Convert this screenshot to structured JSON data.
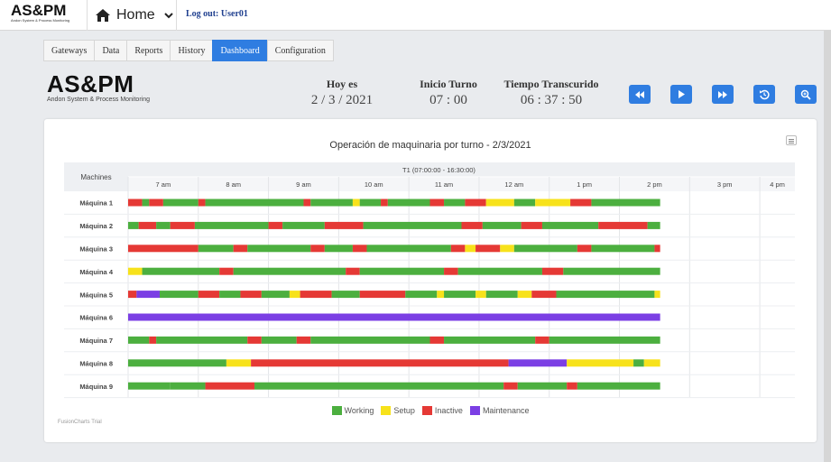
{
  "header": {
    "brand": "AS&PM",
    "brand_subtitle": "Andon System & Process Monitoring",
    "home_label": "Home",
    "logout_label": "Log out: User01"
  },
  "tabs": [
    {
      "label": "Gateways",
      "active": false
    },
    {
      "label": "Data",
      "active": false
    },
    {
      "label": "Reports",
      "active": false
    },
    {
      "label": "History",
      "active": false
    },
    {
      "label": "Dashboard",
      "active": true
    },
    {
      "label": "Configuration",
      "active": false
    }
  ],
  "logo": {
    "title": "AS&PM",
    "subtitle": "Andon System & Process Monitoring"
  },
  "stats": {
    "today_label": "Hoy es",
    "today_value": "2 / 3 / 2021",
    "shift_start_label": "Inicio Turno",
    "shift_start_value": "07 : 00",
    "elapsed_label": "Tiempo Transcurido",
    "elapsed_value": "06 : 37 : 50"
  },
  "controls": [
    "rewind-icon",
    "play-icon",
    "fast-forward-icon",
    "history-icon",
    "zoom-icon"
  ],
  "chart_footer": "FusionCharts Trial",
  "colors": {
    "Working": "#4caf3f",
    "Setup": "#f7e21b",
    "Inactive": "#e53935",
    "Maintenance": "#7b3fe4",
    "accent": "#2f7de1"
  },
  "chart_data": {
    "type": "gantt",
    "title": "Operación de maquinaria por turno - 2/3/2021",
    "row_header": "Machines",
    "shift_label": "T1 (07:00:00 - 16:30:00)",
    "hours": [
      "7 am",
      "8 am",
      "9 am",
      "10 am",
      "11 am",
      "12 am",
      "1 pm",
      "2 pm",
      "3 pm",
      "4 pm"
    ],
    "time_range": [
      7.0,
      16.5
    ],
    "legend": [
      "Working",
      "Setup",
      "Inactive",
      "Maintenance"
    ],
    "machines": [
      {
        "name": "Máquina 1",
        "segments": [
          [
            7.0,
            7.2,
            "Inactive"
          ],
          [
            7.2,
            7.3,
            "Working"
          ],
          [
            7.3,
            7.5,
            "Inactive"
          ],
          [
            7.5,
            8.0,
            "Working"
          ],
          [
            8.0,
            8.1,
            "Inactive"
          ],
          [
            8.1,
            9.5,
            "Working"
          ],
          [
            9.5,
            9.6,
            "Inactive"
          ],
          [
            9.6,
            10.2,
            "Working"
          ],
          [
            10.2,
            10.3,
            "Setup"
          ],
          [
            10.3,
            10.6,
            "Working"
          ],
          [
            10.6,
            10.7,
            "Inactive"
          ],
          [
            10.7,
            11.3,
            "Working"
          ],
          [
            11.3,
            11.5,
            "Inactive"
          ],
          [
            11.5,
            11.8,
            "Working"
          ],
          [
            11.8,
            12.1,
            "Inactive"
          ],
          [
            12.1,
            12.5,
            "Setup"
          ],
          [
            12.5,
            12.8,
            "Working"
          ],
          [
            12.8,
            13.3,
            "Setup"
          ],
          [
            13.3,
            13.6,
            "Inactive"
          ],
          [
            13.6,
            14.58,
            "Working"
          ]
        ]
      },
      {
        "name": "Máquina 2",
        "segments": [
          [
            7.0,
            7.15,
            "Working"
          ],
          [
            7.15,
            7.4,
            "Inactive"
          ],
          [
            7.4,
            7.6,
            "Working"
          ],
          [
            7.6,
            7.95,
            "Inactive"
          ],
          [
            7.95,
            9.0,
            "Working"
          ],
          [
            9.0,
            9.2,
            "Inactive"
          ],
          [
            9.2,
            9.8,
            "Working"
          ],
          [
            9.8,
            10.35,
            "Inactive"
          ],
          [
            10.35,
            11.75,
            "Working"
          ],
          [
            11.75,
            12.05,
            "Inactive"
          ],
          [
            12.05,
            12.6,
            "Working"
          ],
          [
            12.6,
            12.9,
            "Inactive"
          ],
          [
            12.9,
            13.7,
            "Working"
          ],
          [
            13.7,
            14.4,
            "Inactive"
          ],
          [
            14.4,
            14.58,
            "Working"
          ]
        ]
      },
      {
        "name": "Máquina 3",
        "segments": [
          [
            7.0,
            8.0,
            "Inactive"
          ],
          [
            8.0,
            8.5,
            "Working"
          ],
          [
            8.5,
            8.7,
            "Inactive"
          ],
          [
            8.7,
            9.6,
            "Working"
          ],
          [
            9.6,
            9.8,
            "Inactive"
          ],
          [
            9.8,
            10.2,
            "Working"
          ],
          [
            10.2,
            10.4,
            "Inactive"
          ],
          [
            10.4,
            11.6,
            "Working"
          ],
          [
            11.6,
            11.8,
            "Inactive"
          ],
          [
            11.8,
            11.95,
            "Setup"
          ],
          [
            11.95,
            12.3,
            "Inactive"
          ],
          [
            12.3,
            12.5,
            "Setup"
          ],
          [
            12.5,
            13.4,
            "Working"
          ],
          [
            13.4,
            13.6,
            "Inactive"
          ],
          [
            13.6,
            14.5,
            "Working"
          ],
          [
            14.5,
            14.58,
            "Inactive"
          ]
        ]
      },
      {
        "name": "Máquina 4",
        "segments": [
          [
            7.0,
            7.2,
            "Setup"
          ],
          [
            7.2,
            8.3,
            "Working"
          ],
          [
            8.3,
            8.5,
            "Inactive"
          ],
          [
            8.5,
            10.1,
            "Working"
          ],
          [
            10.1,
            10.3,
            "Inactive"
          ],
          [
            10.3,
            11.5,
            "Working"
          ],
          [
            11.5,
            11.7,
            "Inactive"
          ],
          [
            11.7,
            12.9,
            "Working"
          ],
          [
            12.9,
            13.2,
            "Inactive"
          ],
          [
            13.2,
            14.58,
            "Working"
          ]
        ]
      },
      {
        "name": "Máquina 5",
        "segments": [
          [
            7.0,
            7.12,
            "Inactive"
          ],
          [
            7.12,
            7.45,
            "Maintenance"
          ],
          [
            7.45,
            8.0,
            "Working"
          ],
          [
            8.0,
            8.3,
            "Inactive"
          ],
          [
            8.3,
            8.6,
            "Working"
          ],
          [
            8.6,
            8.9,
            "Inactive"
          ],
          [
            8.9,
            9.3,
            "Working"
          ],
          [
            9.3,
            9.45,
            "Setup"
          ],
          [
            9.45,
            9.9,
            "Inactive"
          ],
          [
            9.9,
            10.3,
            "Working"
          ],
          [
            10.3,
            10.95,
            "Inactive"
          ],
          [
            10.95,
            11.4,
            "Working"
          ],
          [
            11.4,
            11.5,
            "Setup"
          ],
          [
            11.5,
            11.95,
            "Working"
          ],
          [
            11.95,
            12.1,
            "Setup"
          ],
          [
            12.1,
            12.55,
            "Working"
          ],
          [
            12.55,
            12.75,
            "Setup"
          ],
          [
            12.75,
            13.1,
            "Inactive"
          ],
          [
            13.1,
            14.5,
            "Working"
          ],
          [
            14.5,
            14.58,
            "Setup"
          ]
        ]
      },
      {
        "name": "Máquina 6",
        "segments": [
          [
            7.0,
            14.58,
            "Maintenance"
          ]
        ]
      },
      {
        "name": "Máquina 7",
        "segments": [
          [
            7.0,
            7.3,
            "Working"
          ],
          [
            7.3,
            7.4,
            "Inactive"
          ],
          [
            7.4,
            8.7,
            "Working"
          ],
          [
            8.7,
            8.9,
            "Inactive"
          ],
          [
            8.9,
            9.4,
            "Working"
          ],
          [
            9.4,
            9.6,
            "Inactive"
          ],
          [
            9.6,
            11.3,
            "Working"
          ],
          [
            11.3,
            11.5,
            "Inactive"
          ],
          [
            11.5,
            12.8,
            "Working"
          ],
          [
            12.8,
            13.0,
            "Inactive"
          ],
          [
            13.0,
            14.58,
            "Working"
          ]
        ]
      },
      {
        "name": "Máquina 8",
        "segments": [
          [
            7.0,
            8.4,
            "Working"
          ],
          [
            8.4,
            8.75,
            "Setup"
          ],
          [
            8.75,
            12.42,
            "Inactive"
          ],
          [
            12.42,
            13.25,
            "Maintenance"
          ],
          [
            13.25,
            14.2,
            "Setup"
          ],
          [
            14.2,
            14.35,
            "Working"
          ],
          [
            14.35,
            14.58,
            "Setup"
          ]
        ]
      },
      {
        "name": "Máquina 9",
        "segments": [
          [
            7.0,
            7.6,
            "Working"
          ],
          [
            7.6,
            8.1,
            "Working"
          ],
          [
            8.1,
            8.8,
            "Inactive"
          ],
          [
            8.8,
            12.35,
            "Working"
          ],
          [
            12.35,
            12.55,
            "Inactive"
          ],
          [
            12.55,
            13.25,
            "Working"
          ],
          [
            13.25,
            13.4,
            "Inactive"
          ],
          [
            13.4,
            14.58,
            "Working"
          ]
        ]
      }
    ]
  }
}
